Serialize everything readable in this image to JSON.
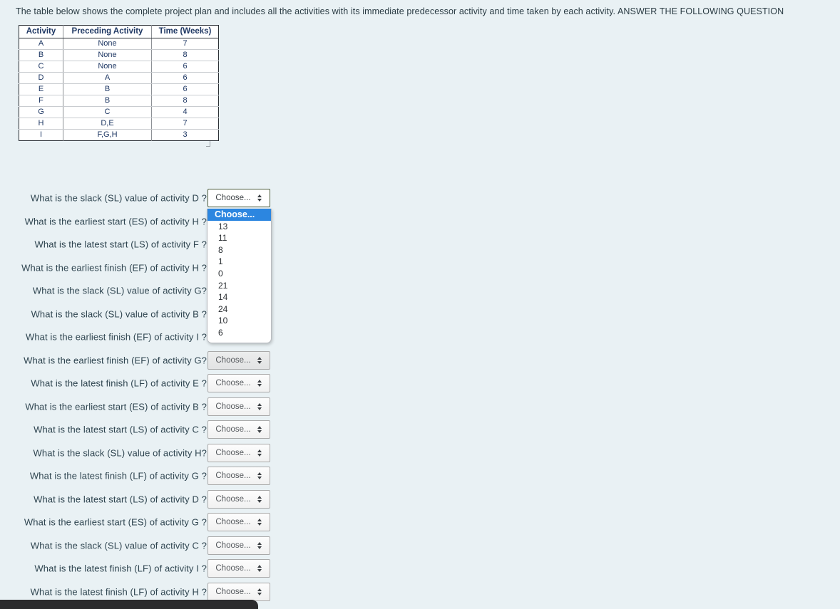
{
  "intro": {
    "text": "The table below shows the complete project plan and includes all the activities with its immediate predecessor activity and time taken by each activity. ANSWER THE FOLLOWING QUESTION"
  },
  "plan_table": {
    "headers": [
      "Activity",
      "Preceding Activity",
      "Time (Weeks)"
    ],
    "rows": [
      [
        "A",
        "None",
        "7"
      ],
      [
        "B",
        "None",
        "8"
      ],
      [
        "C",
        "None",
        "6"
      ],
      [
        "D",
        "A",
        "6"
      ],
      [
        "E",
        "B",
        "6"
      ],
      [
        "F",
        "B",
        "8"
      ],
      [
        "G",
        "C",
        "4"
      ],
      [
        "H",
        "D,E",
        "7"
      ],
      [
        "I",
        "F,G,H",
        "3"
      ]
    ]
  },
  "select_placeholder": "Choose...",
  "dropdown": {
    "options": [
      "Choose...",
      "13",
      "11",
      "8",
      "1",
      "0",
      "21",
      "14",
      "24",
      "10",
      "6"
    ],
    "selected_index": 0,
    "highlight_color": "#2c86e0"
  },
  "questions": [
    {
      "text": "What is the slack (SL) value of activity D ?",
      "value": "Choose...",
      "state": "open"
    },
    {
      "text": "What is the earliest start (ES) of activity H ?",
      "value": "Choose...",
      "state": "hidden"
    },
    {
      "text": "What is the latest start (LS) of activity F ?",
      "value": "Choose...",
      "state": "hidden"
    },
    {
      "text": "What is the earliest finish (EF) of activity H ?",
      "value": "Choose...",
      "state": "hidden"
    },
    {
      "text": "What is the slack (SL) value of activity G?",
      "value": "Choose...",
      "state": "hidden"
    },
    {
      "text": "What is the slack (SL) value of activity B ?",
      "value": "Choose...",
      "state": "hidden"
    },
    {
      "text": "What is the earliest finish (EF) of activity I ?",
      "value": "Choose...",
      "state": "hidden"
    },
    {
      "text": "What is the earliest finish (EF) of activity G?",
      "value": "Choose...",
      "state": "hovered"
    },
    {
      "text": "What is the latest finish (LF) of activity E ?",
      "value": "Choose...",
      "state": "normal"
    },
    {
      "text": "What is the earliest start (ES) of activity B ?",
      "value": "Choose...",
      "state": "normal"
    },
    {
      "text": "What is the latest start (LS) of activity C ?",
      "value": "Choose...",
      "state": "normal"
    },
    {
      "text": "What is the slack (SL) value of activity H?",
      "value": "Choose...",
      "state": "normal"
    },
    {
      "text": "What is the latest finish (LF) of activity G ?",
      "value": "Choose...",
      "state": "normal"
    },
    {
      "text": "What is the latest start (LS) of activity D ?",
      "value": "Choose...",
      "state": "normal"
    },
    {
      "text": "What is the earliest start (ES) of activity G ?",
      "value": "Choose...",
      "state": "normal"
    },
    {
      "text": "What is the slack (SL) value of activity C ?",
      "value": "Choose...",
      "state": "normal"
    },
    {
      "text": "What is the latest finish (LF) of activity I ?",
      "value": "Choose...",
      "state": "normal"
    },
    {
      "text": "What is the latest finish (LF) of activity H ?",
      "value": "Choose...",
      "state": "normal"
    }
  ],
  "colors": {
    "page_background": "#e9f1f4",
    "text": "#2f4550",
    "table_header_text": "#1f3864",
    "accent": "#2c86e0",
    "bottom_bar": "#2b2b2d"
  }
}
